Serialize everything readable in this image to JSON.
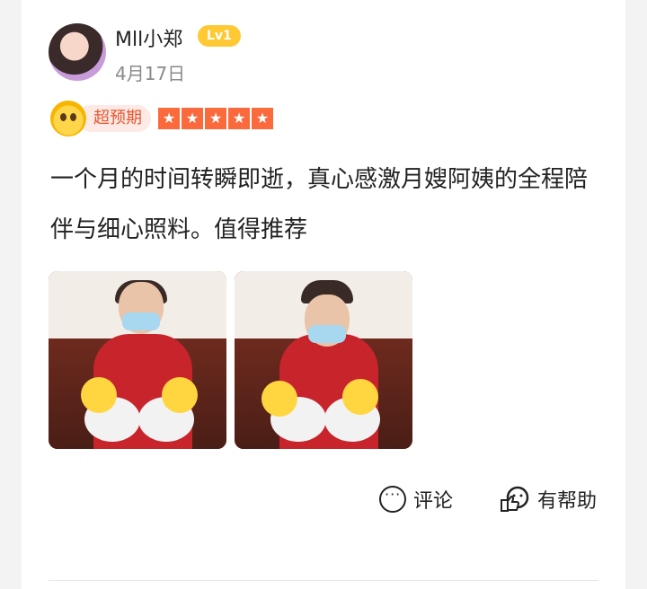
{
  "user": {
    "name": "Mll小郑",
    "level": "Lv1",
    "date": "4月17日"
  },
  "rating": {
    "label": "超预期",
    "stars": 5,
    "star_glyph": "★"
  },
  "review": {
    "text": "一个月的时间转瞬即逝，真心感激月嫂阿姨的全程陪伴与细心照料。值得推荐"
  },
  "photos": [
    "photo-1",
    "photo-2"
  ],
  "actions": {
    "comment_label": "评论",
    "helpful_label": "有帮助"
  },
  "colors": {
    "accent": "#fb6a3d",
    "badge_text": "#e8572f",
    "level_bg": "#ffc933"
  }
}
